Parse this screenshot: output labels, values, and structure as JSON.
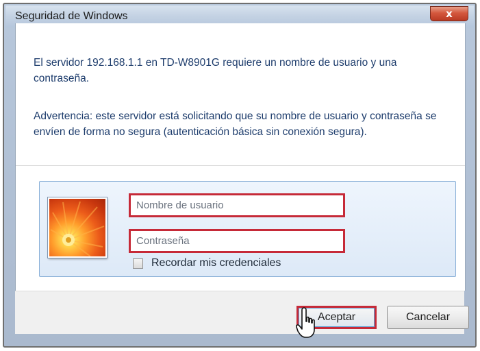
{
  "window": {
    "title": "Seguridad de Windows",
    "close_glyph": "x"
  },
  "message": {
    "line1": "El servidor 192.168.1.1 en TD-W8901G requiere un nombre de usuario y una contraseña.",
    "line2": "Advertencia: este servidor está solicitando que su nombre de usuario y contraseña se envíen de forma no segura (autenticación básica sin conexión segura)."
  },
  "credentials": {
    "avatar_icon": "flower-avatar-icon",
    "username_placeholder": "Nombre de usuario",
    "password_placeholder": "Contraseña",
    "remember_label": "Recordar mis credenciales",
    "remember_checked": false
  },
  "buttons": {
    "accept_label": "Aceptar",
    "cancel_label": "Cancelar"
  },
  "colors": {
    "highlight": "#c62a38",
    "message_text": "#1d3c6c"
  },
  "cursor_icon": "hand-pointer-icon"
}
